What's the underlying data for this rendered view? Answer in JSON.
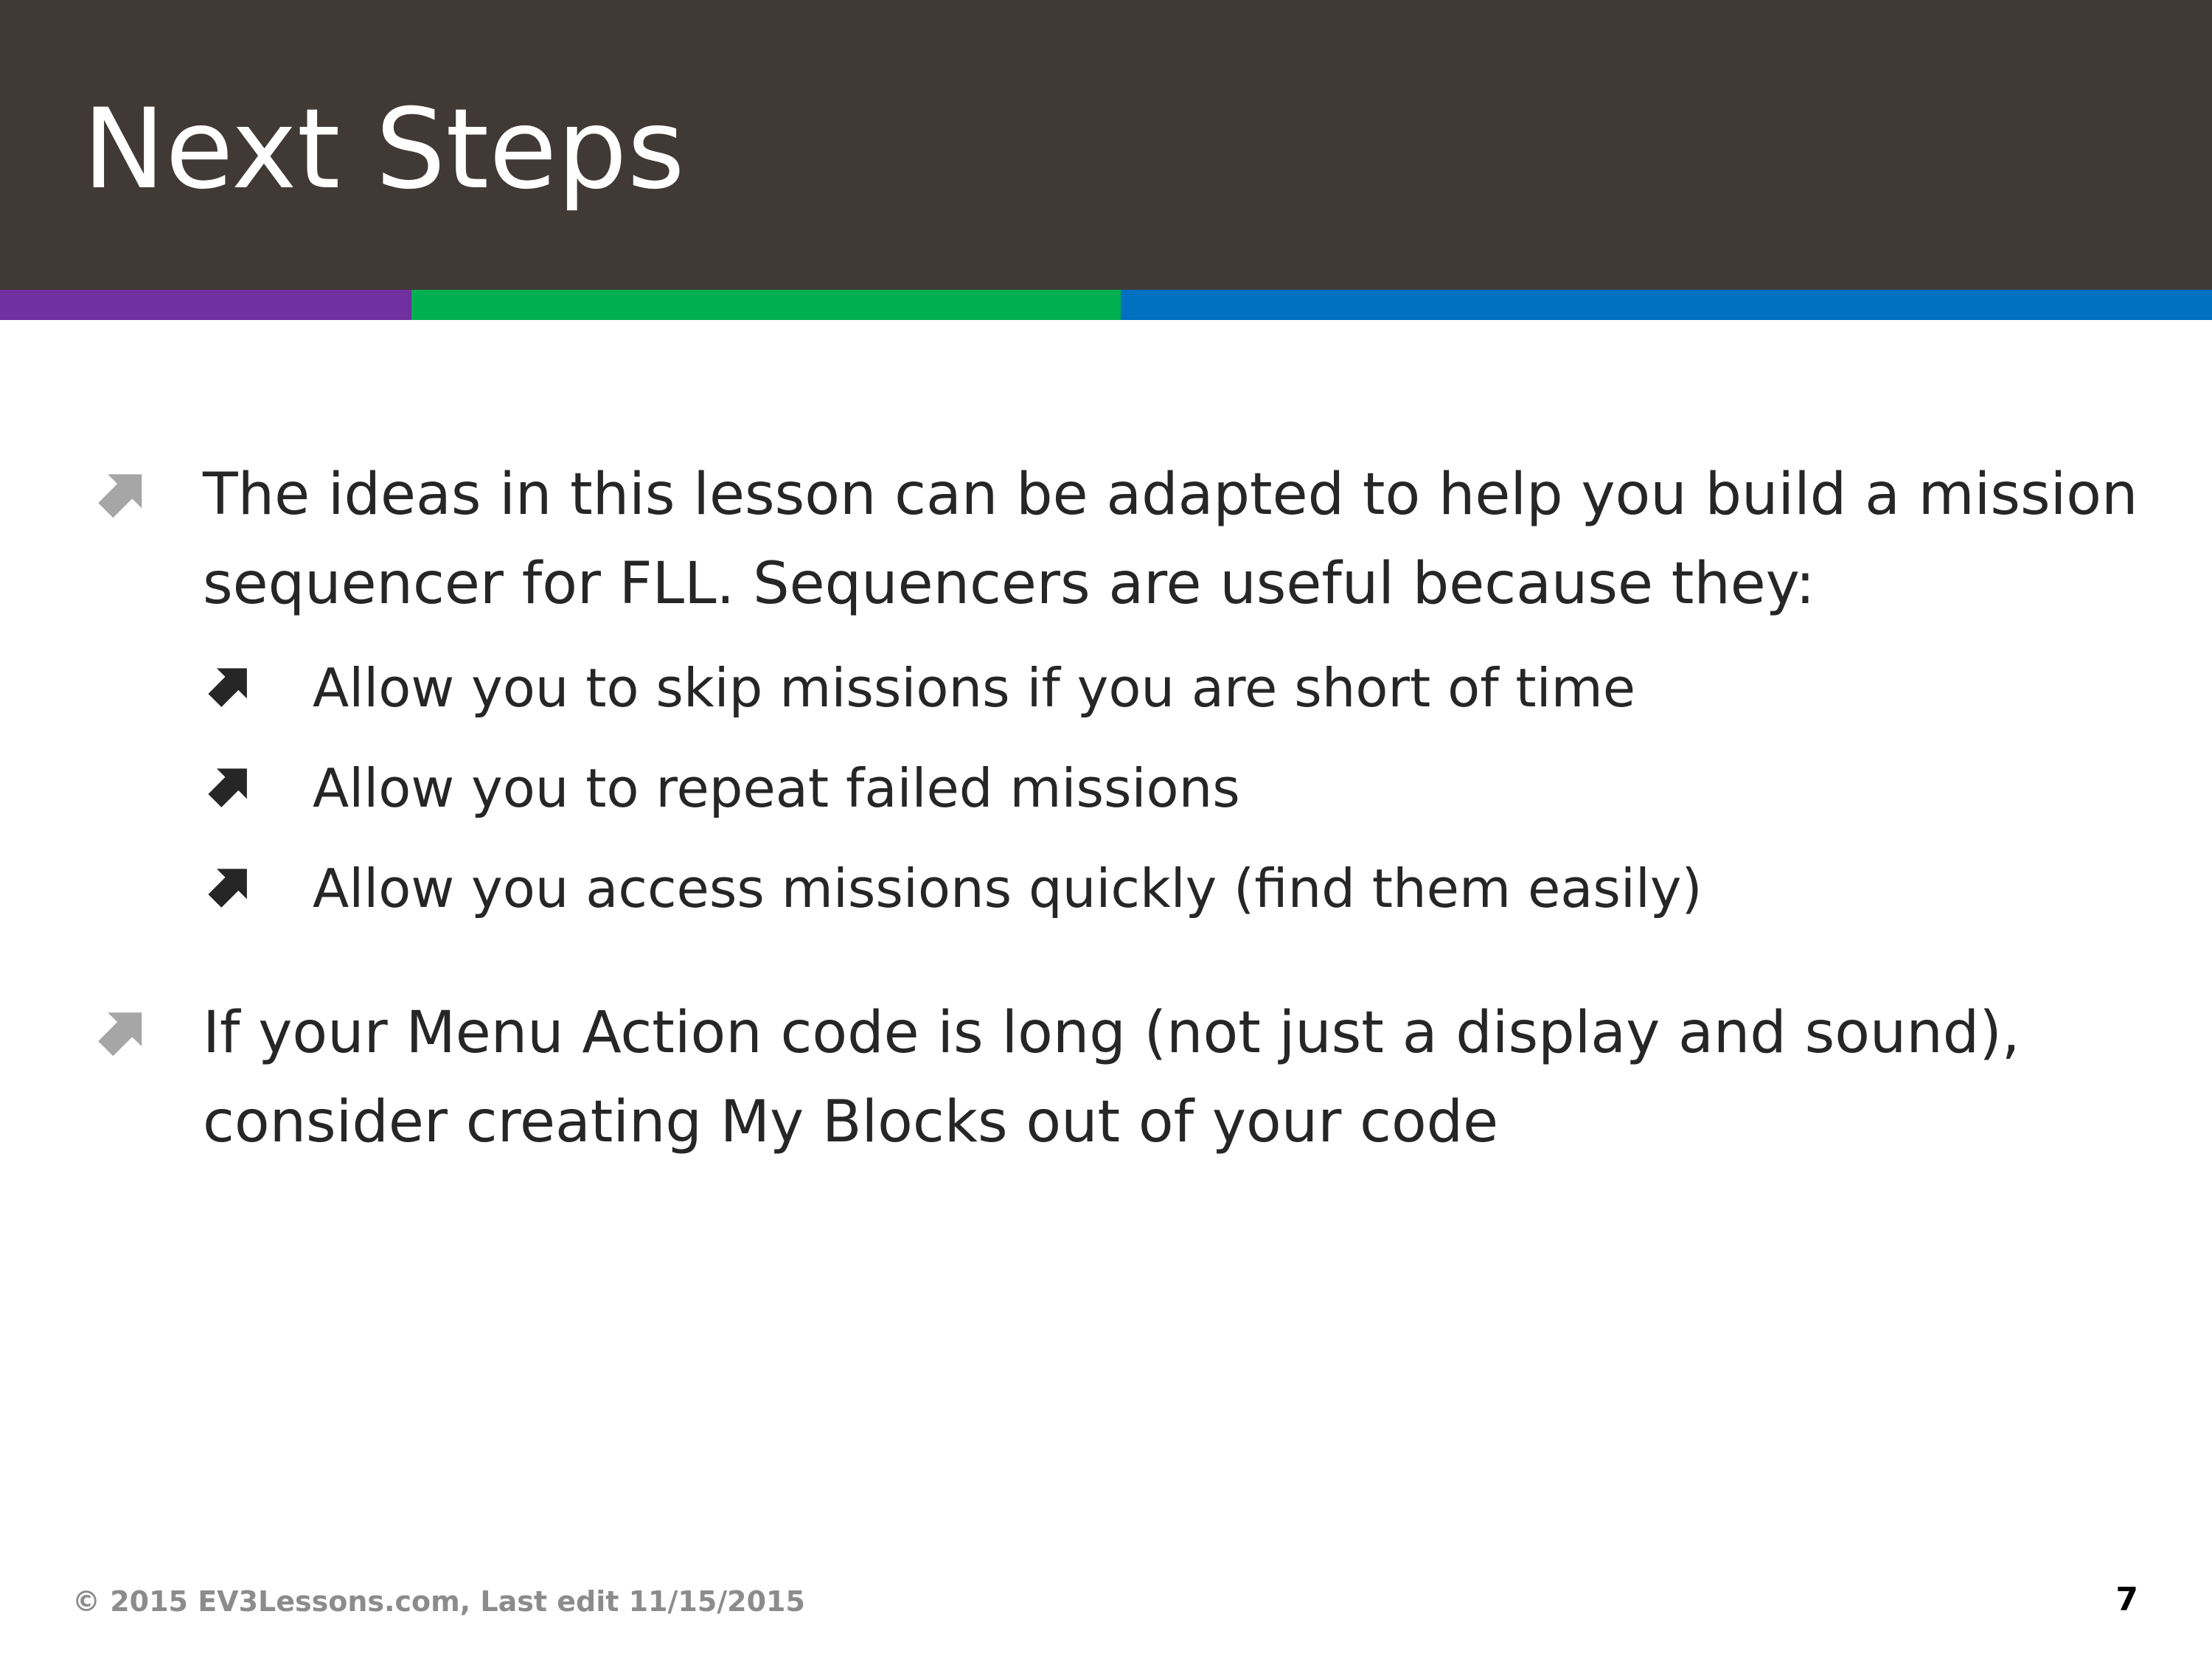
{
  "slide": {
    "title": "Next Steps",
    "accent_colors": {
      "header_bg": "#403935",
      "stripe_1": "#7030a0",
      "stripe_2": "#00b050",
      "stripe_3": "#0070c0",
      "level1_arrow": "#a6a6a6",
      "level2_arrow": "#262626"
    },
    "bullets": [
      {
        "icon": "arrow-up-right-icon",
        "text": "The ideas in this lesson can be adapted to help you build a mission sequencer for FLL. Sequencers are useful because they:",
        "sub_bullets": [
          {
            "icon": "arrow-up-right-icon",
            "text": "Allow you to skip missions if you are short of time"
          },
          {
            "icon": "arrow-up-right-icon",
            "text": "Allow you to repeat failed missions"
          },
          {
            "icon": "arrow-up-right-icon",
            "text": "Allow you access missions quickly (find them easily)"
          }
        ]
      },
      {
        "icon": "arrow-up-right-icon",
        "text": "If your Menu Action code is long (not just a display and sound), consider creating My Blocks out of your code"
      }
    ],
    "footer": {
      "copyright": "© 2015 EV3Lessons.com, Last edit 11/15/2015",
      "page_number": "7"
    }
  }
}
